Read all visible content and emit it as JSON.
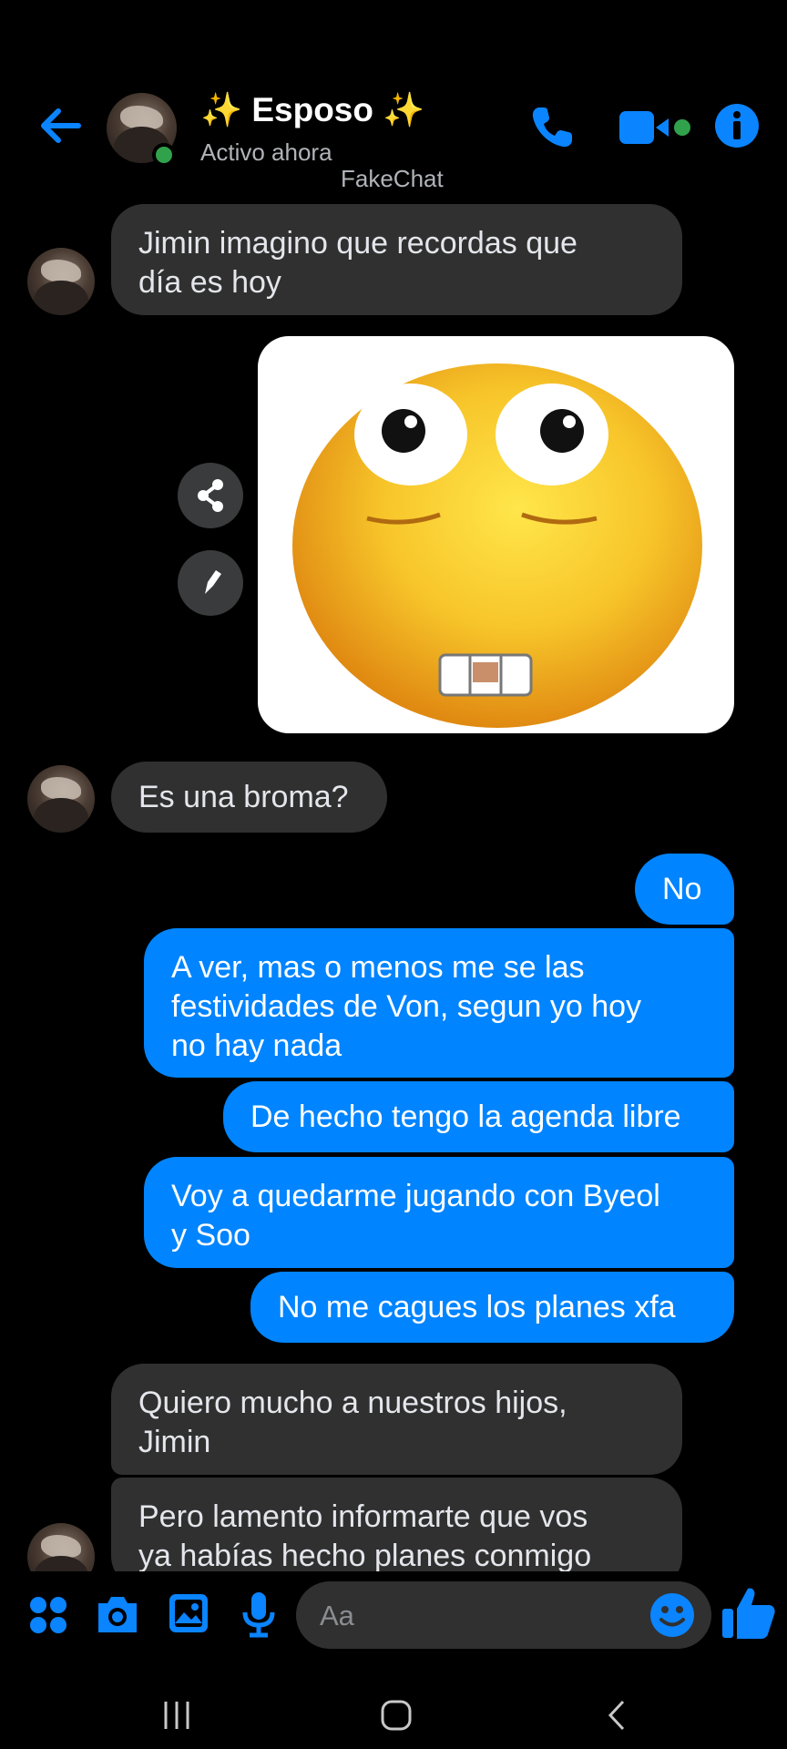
{
  "header": {
    "title": "✨ Esposo ✨",
    "status": "Activo ahora",
    "watermark": "FakeChat"
  },
  "messages": {
    "m1": "Jimin imagino que recordas que\ndía es hoy",
    "m3": "Es una broma?",
    "m4": "No",
    "m5": "A ver, mas o menos me se las\nfestividades de Von, segun yo hoy\nno hay nada",
    "m6": "De hecho tengo la agenda libre",
    "m7": "Voy a quedarme jugando con Byeol\ny Soo",
    "m8": "No me cagues los planes xfa",
    "m9": "Quiero mucho a nuestros hijos,\nJimin",
    "m10": "Pero lamento informarte que vos\nya habías hecho planes conmigo"
  },
  "composer": {
    "placeholder": "Aa"
  },
  "colors": {
    "accent": "#0084ff",
    "received_bubble": "#303030",
    "online": "#31a24c",
    "background": "#000000"
  },
  "icons": [
    "back-arrow-icon",
    "phone-icon",
    "video-icon",
    "info-icon",
    "share-icon",
    "edit-icon",
    "apps-icon",
    "camera-icon",
    "gallery-icon",
    "microphone-icon",
    "emoji-icon",
    "thumbs-up-icon",
    "recents-icon",
    "home-icon",
    "back-nav-icon"
  ]
}
